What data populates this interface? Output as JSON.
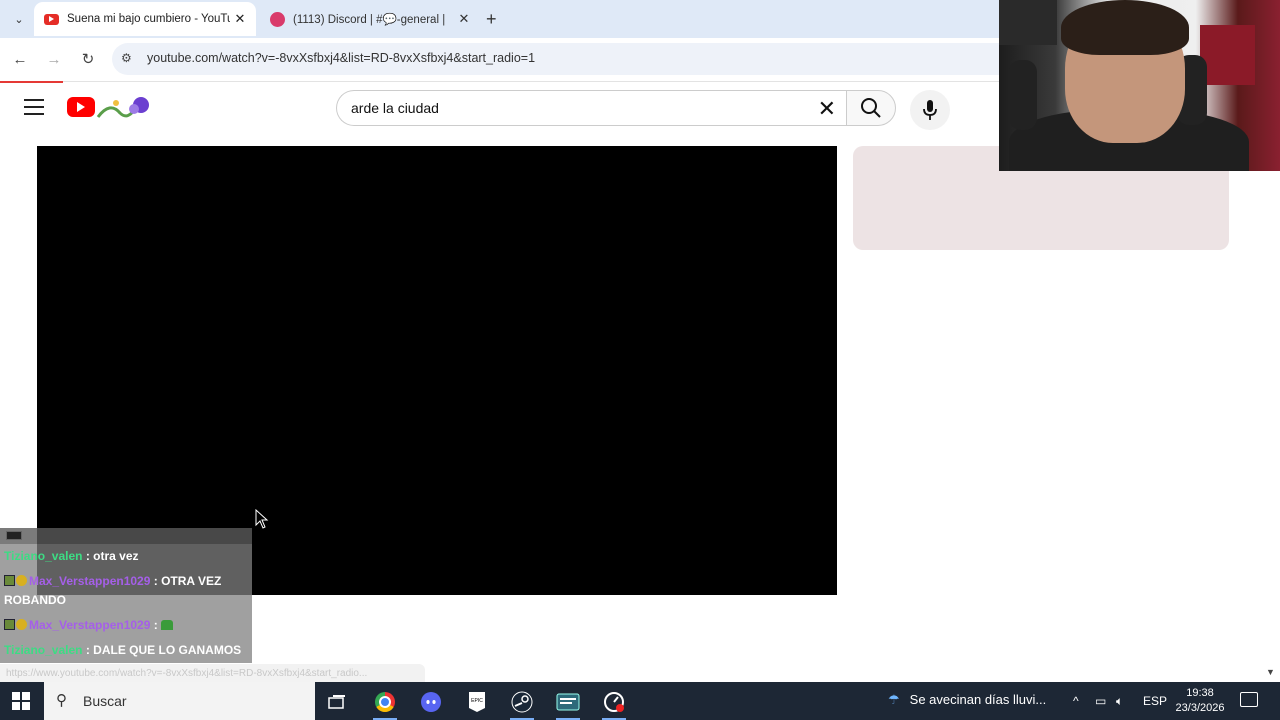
{
  "browser": {
    "tabs": [
      {
        "title": "Suena mi bajo cumbiero - YouTube",
        "active": true,
        "favicon": "youtube-icon"
      },
      {
        "title": "(1113) Discord | #💬-general | ",
        "active": false,
        "favicon": "discord-icon"
      }
    ],
    "url": "youtube.com/watch?v=-8vxXsfbxj4&list=RD-8vxXsfbxj4&start_radio=1",
    "status_url": "https://www.youtube.com/watch?v=-8vxXsfbxj4&list=RD-8vxXsfbxj4&start_radio..."
  },
  "youtube": {
    "search_query": "arde la ciudad"
  },
  "chat": {
    "messages": [
      {
        "user": "Tiziano_valen",
        "text": ": otra vez",
        "color": "#3ddc84",
        "badges": false
      },
      {
        "user": "Max_Verstappen1029",
        "text": ": OTRA VEZ ROBANDO",
        "color": "#a55fe8",
        "badges": true
      },
      {
        "user": "Max_Verstappen1029",
        "text": ":",
        "color": "#a55fe8",
        "badges": true,
        "emoji": true
      },
      {
        "user": "Tiziano_valen",
        "text": ": DALE QUE LO GANAMOS",
        "color": "#3ddc84",
        "badges": false
      }
    ]
  },
  "taskbar": {
    "search_placeholder": "Buscar",
    "weather": "Se avecinan días lluvi...",
    "language": "ESP",
    "time": "19:38",
    "date": "23/3/2026"
  },
  "colors": {
    "youtube_red": "#ff0000",
    "tabbar": "#dfe9f7",
    "taskbar": "#1d2735"
  }
}
